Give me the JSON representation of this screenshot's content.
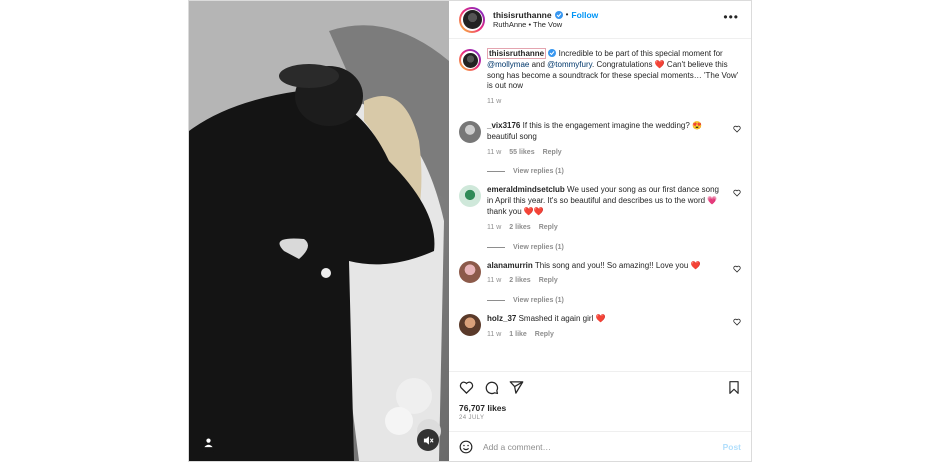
{
  "header": {
    "username": "thisisruthanne",
    "follow_label": "Follow",
    "subtitle": "RuthAnne • The Vow",
    "more": "•••"
  },
  "caption": {
    "username": "thisisruthanne",
    "text_1": "Incredible to be part of this special moment for ",
    "mention_1": "@mollymae",
    "text_2": " and ",
    "mention_2": "@tommyfury",
    "text_3": ". Congratulations ❤️ Can't believe this song has become a soundtrack for these special moments… 'The Vow' is out now",
    "time": "11 w"
  },
  "comments": [
    {
      "username": "_vix3176",
      "text": "If this is the engagement imagine the wedding? 😍 beautiful song",
      "time": "11 w",
      "likes": "55 likes",
      "reply": "Reply",
      "view_replies": "View replies (1)"
    },
    {
      "username": "emeraldmindsetclub",
      "text": "We used your song as our first dance song in April this year. It's so beautiful and describes us to the word 💗 thank you ❤️❤️",
      "time": "11 w",
      "likes": "2 likes",
      "reply": "Reply",
      "view_replies": "View replies (1)"
    },
    {
      "username": "alanamurrin",
      "text": "This song and you!! So amazing!! Love you ❤️",
      "time": "11 w",
      "likes": "2 likes",
      "reply": "Reply",
      "view_replies": "View replies (1)"
    },
    {
      "username": "holz_37",
      "text": "Smashed it again girl ❤️",
      "time": "11 w",
      "likes": "1 like",
      "reply": "Reply"
    }
  ],
  "likes": "76,707 likes",
  "date": "24 JULY",
  "add_comment": {
    "placeholder": "Add a comment…",
    "post_label": "Post"
  },
  "icons": [
    "heart-icon",
    "comment-icon",
    "share-icon",
    "bookmark-icon",
    "emoji-icon",
    "tag-user-icon",
    "audio-muted-icon",
    "verified-badge-icon",
    "more-options-icon"
  ],
  "colors": {
    "link_blue": "#0095f6",
    "mention": "#00376b",
    "verified": "#3897f0",
    "muted_text": "#8e8e8e",
    "post_disabled": "#b2dffc"
  }
}
